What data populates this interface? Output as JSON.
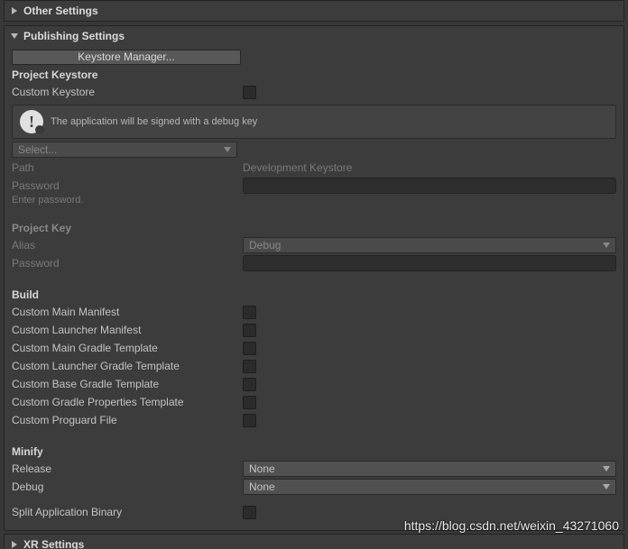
{
  "sections": {
    "other": {
      "title": "Other Settings"
    },
    "publishing": {
      "title": "Publishing Settings",
      "keystore_manager_btn": "Keystore Manager...",
      "project_keystore_heading": "Project Keystore",
      "custom_keystore_label": "Custom Keystore",
      "info_message": "The application will be signed with a debug key",
      "select_dropdown": "Select...",
      "path_label": "Path",
      "path_value": "Development Keystore",
      "keystore_password_label": "Password",
      "keystore_password_hint": "Enter password.",
      "project_key_heading": "Project Key",
      "alias_label": "Alias",
      "alias_value": "Debug",
      "key_password_label": "Password",
      "build_heading": "Build",
      "build_items": [
        "Custom Main Manifest",
        "Custom Launcher Manifest",
        "Custom Main Gradle Template",
        "Custom Launcher Gradle Template",
        "Custom Base Gradle Template",
        "Custom Gradle Properties Template",
        "Custom Proguard File"
      ],
      "minify_heading": "Minify",
      "minify_release_label": "Release",
      "minify_release_value": "None",
      "minify_debug_label": "Debug",
      "minify_debug_value": "None",
      "split_binary_label": "Split Application Binary"
    },
    "xr": {
      "title": "XR Settings"
    }
  },
  "watermark": "https://blog.csdn.net/weixin_43271060"
}
